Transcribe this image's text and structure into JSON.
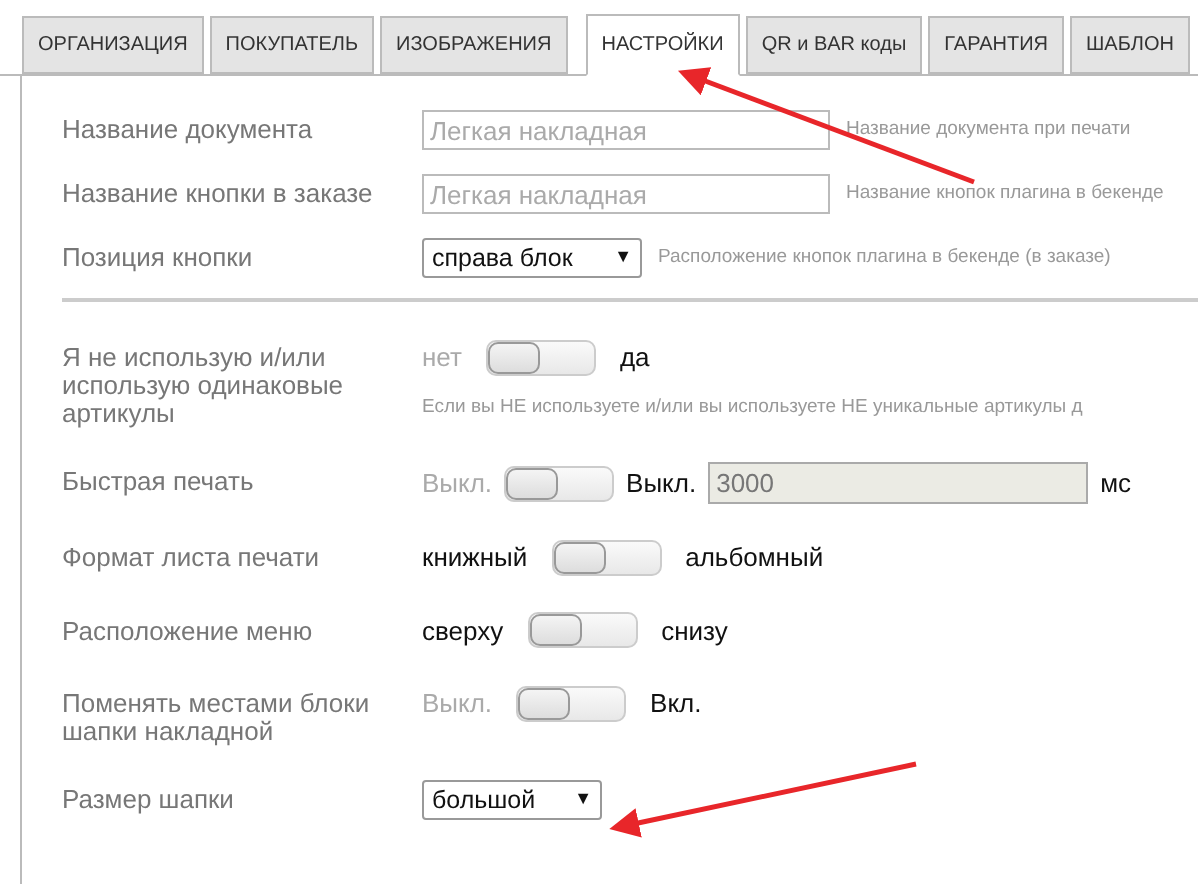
{
  "tabs": [
    {
      "label": "ОРГАНИЗАЦИЯ",
      "selected": false
    },
    {
      "label": "ПОКУПАТЕЛЬ",
      "selected": false
    },
    {
      "label": "ИЗОБРАЖЕНИЯ",
      "selected": false
    },
    {
      "label": "НАСТРОЙКИ",
      "selected": true
    },
    {
      "label": "QR и BAR коды",
      "selected": false
    },
    {
      "label": "ГАРАНТИЯ",
      "selected": false
    },
    {
      "label": "ШАБЛОН",
      "selected": false
    }
  ],
  "settings": [
    {
      "kind": "text",
      "label": "Название документа",
      "placeholder": "Легкая накладная",
      "hint": "Название документа при печати"
    },
    {
      "kind": "text",
      "label": "Название кнопки в заказе",
      "placeholder": "Легкая накладная",
      "hint": "Название кнопок плагина в бекенде"
    },
    {
      "kind": "select",
      "label": "Позиция кнопки",
      "value": "справа блок",
      "caret": "▼",
      "narrow": false,
      "hint": "Расположение кнопок плагина в бекенде (в заказе)"
    },
    {
      "kind": "divider"
    },
    {
      "kind": "toggle",
      "label": "Я не использую и/или использую одинаковые артикулы",
      "off_label": "нет",
      "off_label_dimmed": true,
      "on_label": "да",
      "on": false,
      "hint": "Если вы НЕ используете и/или вы используете НЕ уникальные артикулы д"
    },
    {
      "kind": "toggle",
      "label": "Быстрая печать",
      "off_label": "Выкл.",
      "off_label_dimmed": true,
      "on_label": "Выкл.",
      "on": false,
      "extra_value": "3000",
      "extra_unit": "мс"
    },
    {
      "kind": "toggle",
      "label": "Формат листа печати",
      "off_label": "книжный",
      "off_label_dimmed": false,
      "on_label": "альбомный",
      "on": false
    },
    {
      "kind": "toggle",
      "label": "Расположение меню",
      "off_label": "сверху",
      "off_label_dimmed": false,
      "on_label": "снизу",
      "on": false
    },
    {
      "kind": "toggle",
      "label": "Поменять местами блоки шапки накладной",
      "off_label": "Выкл.",
      "off_label_dimmed": true,
      "on_label": "Вкл.",
      "on": false
    },
    {
      "kind": "select",
      "label": "Размер шапки",
      "value": "большой",
      "caret": "▼",
      "narrow": true
    }
  ]
}
